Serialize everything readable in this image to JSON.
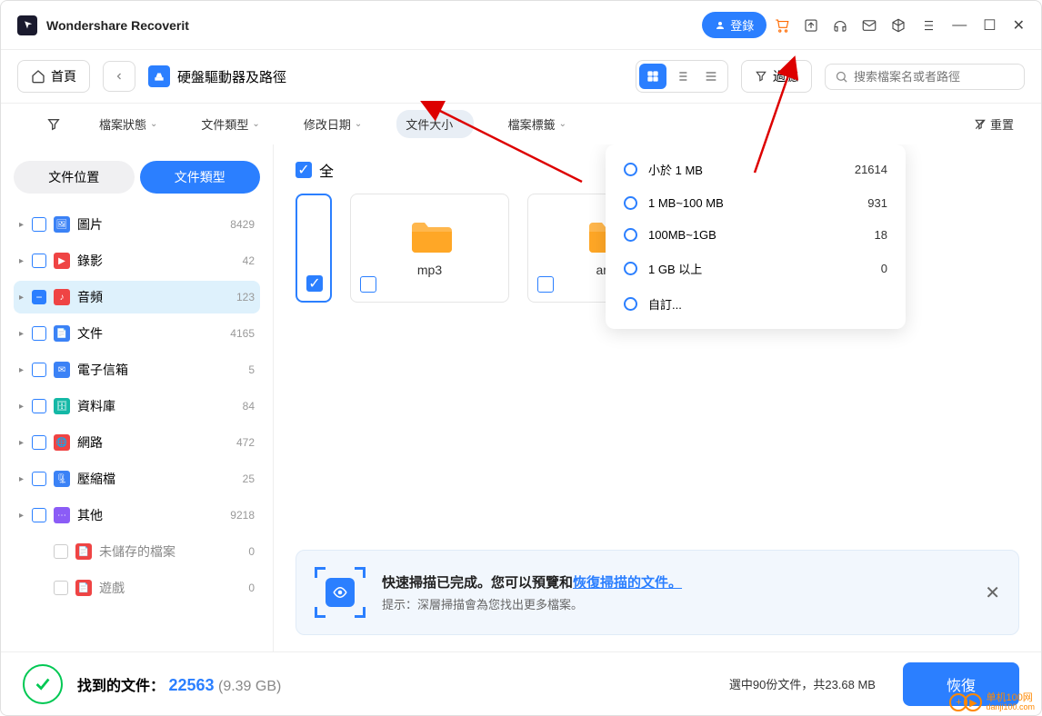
{
  "title": "Wondershare Recoverit",
  "titlebar": {
    "login": "登錄"
  },
  "toolbar": {
    "home": "首頁",
    "location": "硬盤驅動器及路徑",
    "filter": "過濾",
    "search_placeholder": "搜索檔案名或者路徑"
  },
  "filters": {
    "status": "檔案狀態",
    "type": "文件類型",
    "date": "修改日期",
    "size": "文件大小",
    "tags": "檔案標籤",
    "reset": "重置"
  },
  "sidebar": {
    "tab_location": "文件位置",
    "tab_type": "文件類型",
    "items": [
      {
        "icon": "🖼",
        "color": "#3b82f6",
        "label": "圖片",
        "count": "8429"
      },
      {
        "icon": "▶",
        "color": "#ef4444",
        "label": "錄影",
        "count": "42"
      },
      {
        "icon": "♪",
        "color": "#ef4444",
        "label": "音頻",
        "count": "123",
        "selected": true,
        "minus": true
      },
      {
        "icon": "📄",
        "color": "#3b82f6",
        "label": "文件",
        "count": "4165"
      },
      {
        "icon": "✉",
        "color": "#3b82f6",
        "label": "電子信箱",
        "count": "5"
      },
      {
        "icon": "🗄",
        "color": "#14b8a6",
        "label": "資料庫",
        "count": "84"
      },
      {
        "icon": "🌐",
        "color": "#ef4444",
        "label": "網路",
        "count": "472"
      },
      {
        "icon": "🗜",
        "color": "#3b82f6",
        "label": "壓縮檔",
        "count": "25"
      },
      {
        "icon": "⋯",
        "color": "#8b5cf6",
        "label": "其他",
        "count": "9218"
      }
    ],
    "subs": [
      {
        "label": "未儲存的檔案",
        "count": "0"
      },
      {
        "label": "遊戲",
        "count": "0"
      }
    ]
  },
  "size_options": [
    {
      "label": "小於 1 MB",
      "count": "21614"
    },
    {
      "label": "1 MB~100 MB",
      "count": "931"
    },
    {
      "label": "100MB~1GB",
      "count": "18"
    },
    {
      "label": "1 GB 以上",
      "count": "0"
    },
    {
      "label": "自訂...",
      "count": ""
    }
  ],
  "select_all": "全",
  "folders": [
    {
      "label": "mp3",
      "selected": false
    },
    {
      "label": "amr",
      "selected": false
    }
  ],
  "banner": {
    "title_pre": "快速掃描已完成。您可以預覽和",
    "title_link": "恢復掃描的文件。",
    "sub": "提示：深層掃描會為您找出更多檔案。"
  },
  "footer": {
    "found_label": "找到的文件：",
    "found_num": "22563",
    "found_size": "(9.39 GB)",
    "sel_info": "選中90份文件，共23.68 MB",
    "recover": "恢復"
  },
  "watermark": "单机100网\ndanji100.com"
}
